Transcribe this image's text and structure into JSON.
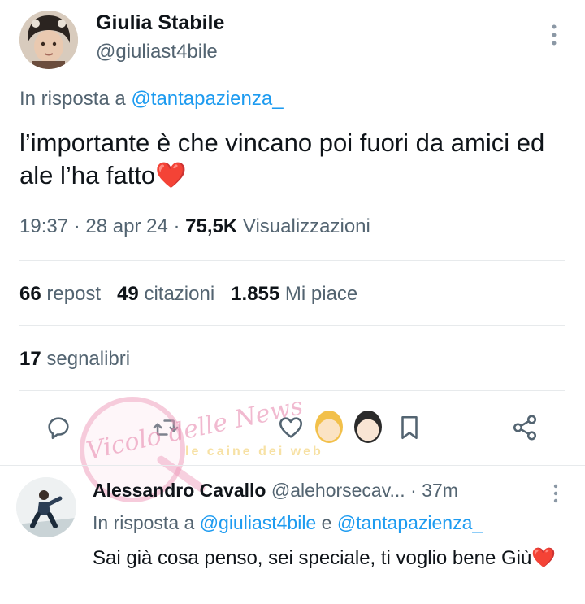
{
  "tweet": {
    "author_name": "Giulia Stabile",
    "author_handle": "@giuliast4bile",
    "reply_prefix": "In risposta a",
    "reply_mention": "@tantapazienza_",
    "text": "l’importante è che vincano poi fuori da amici ed ale l’ha fatto❤️",
    "time": "19:37",
    "date": "28 apr 24",
    "separator": "·",
    "views_count": "75,5K",
    "views_label": "Visualizzazioni",
    "reposts_count": "66",
    "reposts_label": "repost",
    "quotes_count": "49",
    "quotes_label": "citazioni",
    "likes_count": "1.855",
    "likes_label": "Mi piace",
    "bookmarks_count": "17",
    "bookmarks_label": "segnalibri"
  },
  "actions": [
    "reply-icon",
    "repost-icon",
    "like-icon",
    "bookmark-icon",
    "share-icon"
  ],
  "watermark": {
    "logo_text": "Vicolo delle News",
    "banner_text": "le caine dei web"
  },
  "reply": {
    "author_name": "Alessandro Cavallo",
    "author_handle": "@alehorsecav...",
    "separator": "·",
    "time": "37m",
    "reply_prefix": "In risposta a",
    "mention_1": "@giuliast4bile",
    "conjunction": "e",
    "mention_2": "@tantapazienza_",
    "text": "Sai già cosa penso, sei speciale, ti voglio bene Giù❤️"
  },
  "colors": {
    "text_primary": "#0f1419",
    "text_secondary": "#536471",
    "link": "#1d9bf0",
    "divider": "#e7eaec",
    "watermark_pink": "#ee96b9"
  }
}
